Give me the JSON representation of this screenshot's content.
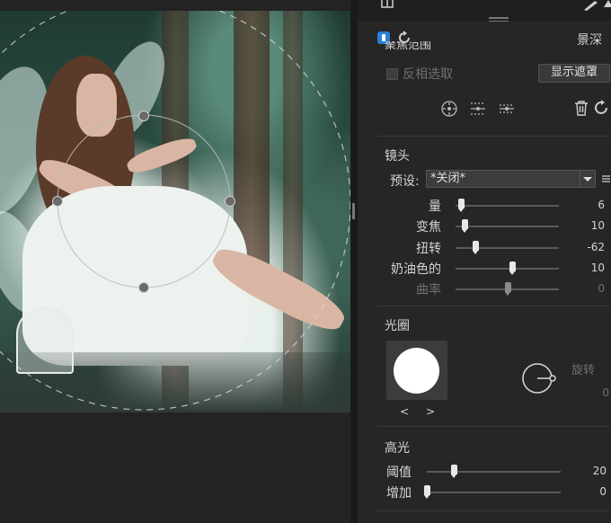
{
  "panel": {
    "top_icon": "layers-icon",
    "header_title": "景深",
    "partial_section_title": "聚焦范围",
    "invert_selection": {
      "label": "反相选取",
      "checked": false
    },
    "show_mask_button": "显示遮罩",
    "lens": {
      "title": "镜头",
      "preset_label": "预设:",
      "preset_value": "*关闭*",
      "sliders": [
        {
          "label": "量",
          "value": "6",
          "fraction": 0.05,
          "disabled": false
        },
        {
          "label": "变焦",
          "value": "10",
          "fraction": 0.09,
          "disabled": false
        },
        {
          "label": "扭转",
          "value": "-62",
          "fraction": 0.19,
          "disabled": false
        },
        {
          "label": "奶油色的",
          "value": "10",
          "fraction": 0.55,
          "disabled": false
        },
        {
          "label": "曲率",
          "value": "0",
          "fraction": 0.5,
          "disabled": true
        }
      ]
    },
    "aperture": {
      "title": "光圈",
      "prev_label": "<",
      "next_label": ">",
      "rotate_label": "旋转",
      "rotate_value": "0"
    },
    "highlights": {
      "title": "高光",
      "sliders": [
        {
          "label": "阈值",
          "value": "20",
          "fraction": 0.2
        },
        {
          "label": "增加",
          "value": "0",
          "fraction": 0.0
        }
      ]
    }
  },
  "colors": {
    "panel_bg": "#262626",
    "accent_blue": "#2a7fd4",
    "canvas_bg": "#232323"
  }
}
